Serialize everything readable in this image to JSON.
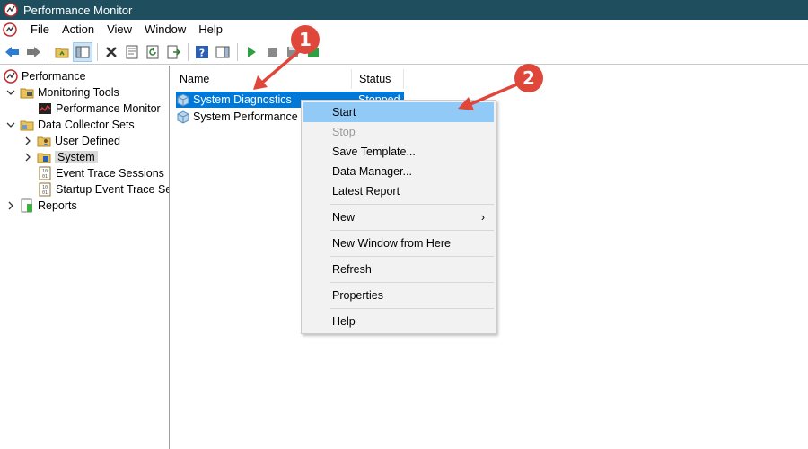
{
  "window": {
    "title": "Performance Monitor"
  },
  "menubar": {
    "items": [
      "File",
      "Action",
      "View",
      "Window",
      "Help"
    ]
  },
  "toolbar": {
    "buttons": [
      "back-icon",
      "forward-icon",
      "up-folder-icon",
      "show-hide-tree-icon",
      "delete-icon",
      "properties-icon",
      "refresh-icon",
      "export-list-icon",
      "help-icon",
      "show-action-pane-icon",
      "start-icon",
      "stop-icon",
      "save-icon",
      "new-icon"
    ]
  },
  "tree": {
    "items": [
      {
        "label": "Performance",
        "level": 0,
        "expand": "none"
      },
      {
        "label": "Monitoring Tools",
        "level": 1,
        "expand": "open"
      },
      {
        "label": "Performance Monitor",
        "level": 2,
        "expand": "none"
      },
      {
        "label": "Data Collector Sets",
        "level": 1,
        "expand": "open"
      },
      {
        "label": "User Defined",
        "level": 2,
        "expand": "closed"
      },
      {
        "label": "System",
        "level": 2,
        "expand": "closed",
        "selected": true
      },
      {
        "label": "Event Trace Sessions",
        "level": 2,
        "expand": "none"
      },
      {
        "label": "Startup Event Trace Sessions",
        "level": 2,
        "expand": "none"
      },
      {
        "label": "Reports",
        "level": 1,
        "expand": "closed"
      }
    ]
  },
  "list": {
    "columns": [
      "Name",
      "Status"
    ],
    "rows": [
      {
        "name": "System Diagnostics",
        "status": "Stopped",
        "selected": true
      },
      {
        "name": "System Performance",
        "status": ""
      }
    ]
  },
  "context_menu": {
    "items": [
      {
        "label": "Start",
        "state": "hover"
      },
      {
        "label": "Stop",
        "state": "disabled"
      },
      {
        "label": "Save Template...",
        "state": "normal"
      },
      {
        "label": "Data Manager...",
        "state": "normal"
      },
      {
        "label": "Latest Report",
        "state": "normal"
      },
      {
        "label": "New",
        "state": "submenu"
      },
      {
        "label": "New Window from Here",
        "state": "normal"
      },
      {
        "label": "Refresh",
        "state": "normal"
      },
      {
        "label": "Properties",
        "state": "normal"
      },
      {
        "label": "Help",
        "state": "normal"
      }
    ],
    "submenu_arrow": "›"
  },
  "annotations": {
    "badge_1": "1",
    "badge_2": "2",
    "color": "#e0473b"
  },
  "colors": {
    "titlebar": "#1f4e5f",
    "selection": "#0078d7",
    "menu_hover": "#91c9f7"
  }
}
